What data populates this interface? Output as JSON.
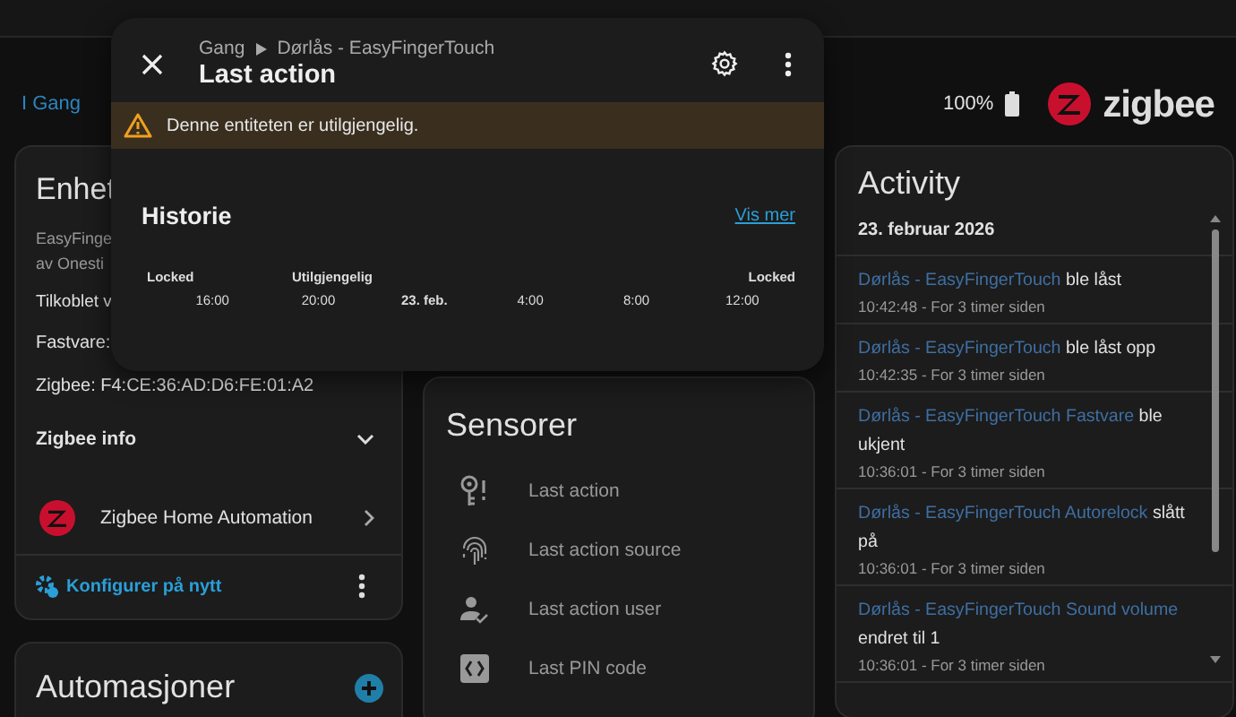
{
  "header": {
    "area_link": "I Gang",
    "battery": "100%",
    "brand": "zigbee"
  },
  "device_card": {
    "title": "Enhet",
    "lines": [
      "EasyFinge",
      "av Onesti",
      "Tilkoblet v",
      "Fastvare:",
      "Zigbee: F4:CE:36:AD:D6:FE:01:A2"
    ],
    "zigbee_info": {
      "label": "Zigbee info",
      "expanded": false
    },
    "integration": "Zigbee Home Automation",
    "reconfigure": "Konfigurer på nytt"
  },
  "automations_card": {
    "title": "Automasjoner"
  },
  "sensors_card": {
    "title": "Sensorer",
    "items": [
      {
        "label": "Last action",
        "kind": "key"
      },
      {
        "label": "Last action source",
        "kind": "fingerprint"
      },
      {
        "label": "Last action user",
        "kind": "user"
      },
      {
        "label": "Last PIN code",
        "kind": "code"
      }
    ]
  },
  "activity": {
    "title": "Activity",
    "date": "23. februar 2026",
    "entries": [
      {
        "entity": "Dørlås - EasyFingerTouch",
        "message": "ble låst",
        "time": "10:42:48 - For 3 timer siden"
      },
      {
        "entity": "Dørlås - EasyFingerTouch",
        "message": "ble låst opp",
        "time": "10:42:35 - For 3 timer siden"
      },
      {
        "entity": "Dørlås - EasyFingerTouch Fastvare",
        "message": "ble ukjent",
        "time": "10:36:01 - For 3 timer siden"
      },
      {
        "entity": "Dørlås - EasyFingerTouch Autorelock",
        "message": "slått på",
        "time": "10:36:01 - For 3 timer siden"
      },
      {
        "entity": "Dørlås - EasyFingerTouch Sound volume",
        "message": "endret til 1",
        "time": "10:36:01 - For 3 timer siden"
      }
    ]
  },
  "dialog": {
    "breadcrumb": [
      "Gang",
      "Dørlås - EasyFingerTouch"
    ],
    "title": "Last action",
    "warning": "Denne entiteten er utilgjengelig.",
    "history": {
      "title": "Historie",
      "more_link": "Vis mer",
      "states": [
        "Locked",
        "Utilgjengelig",
        "Locked"
      ],
      "ticks": [
        {
          "label": "16:00",
          "bold": false
        },
        {
          "label": "20:00",
          "bold": false
        },
        {
          "label": "23. feb.",
          "bold": true
        },
        {
          "label": "4:00",
          "bold": false
        },
        {
          "label": "8:00",
          "bold": false
        },
        {
          "label": "12:00",
          "bold": false
        }
      ]
    }
  }
}
